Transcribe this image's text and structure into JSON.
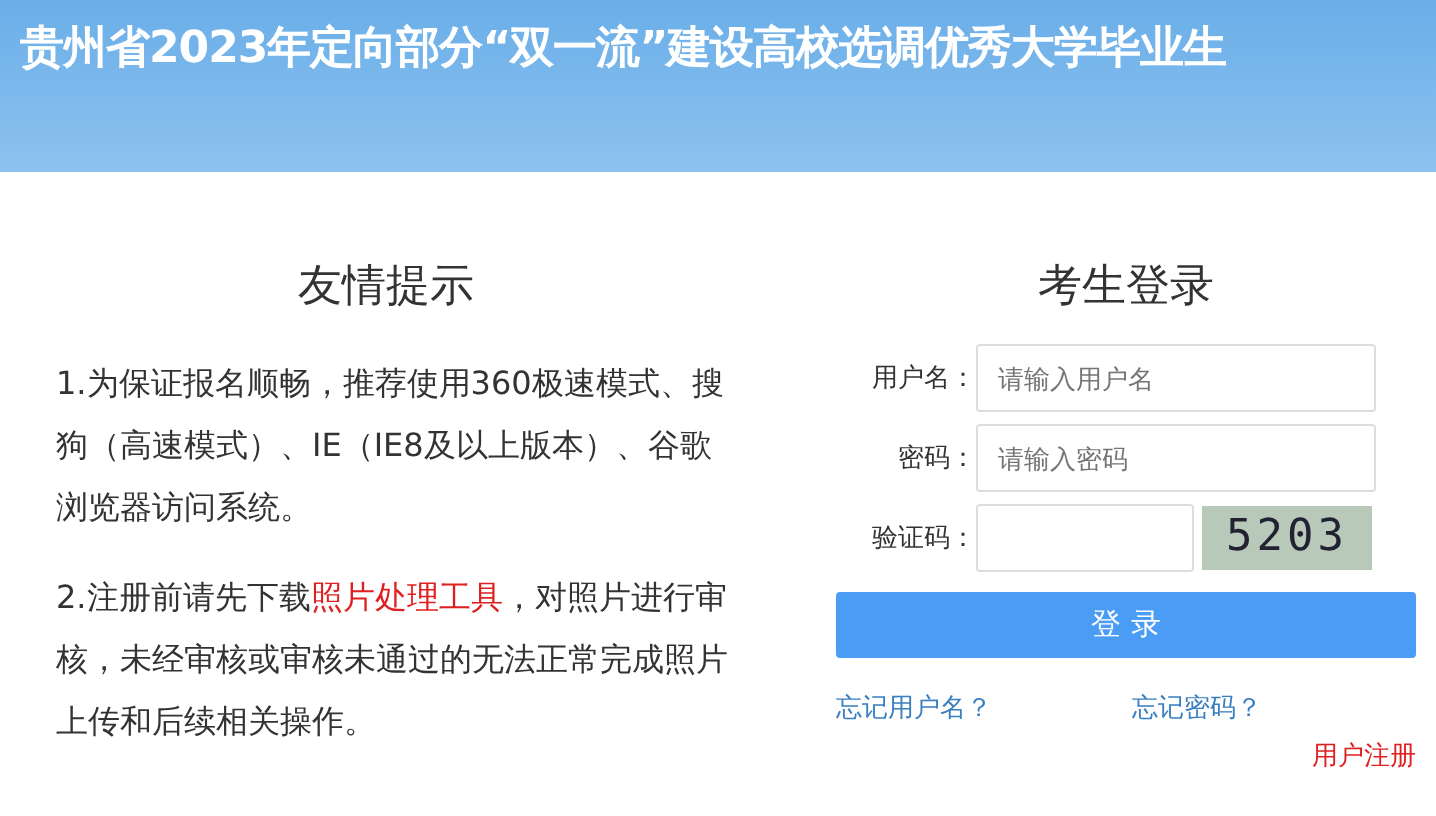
{
  "header": {
    "title": "贵州省2023年定向部分“双一流”建设高校选调优秀大学毕业生"
  },
  "notice": {
    "title": "友情提示",
    "paragraphs": [
      {
        "before": "1.为保证报名顺畅，推荐使用360极速模式、搜狗（高速模式）、IE（IE8及以上版本）、谷歌浏览器访问系统。"
      },
      {
        "before": "2.注册前请先下载",
        "link": "照片处理工具",
        "after": "，对照片进行审核，未经审核或审核未通过的无法正常完成照片上传和后续相关操作。"
      }
    ]
  },
  "login": {
    "title": "考生登录",
    "fields": [
      {
        "kind": "text",
        "label": "用户名：",
        "placeholder": "请输入用户名"
      },
      {
        "kind": "password",
        "label": "密码：",
        "placeholder": "请输入密码"
      },
      {
        "kind": "captcha",
        "label": "验证码：",
        "captcha": "5203"
      }
    ],
    "button": "登 录",
    "forgot_username": "忘记用户名？",
    "forgot_password": "忘记密码？",
    "register": "用户注册"
  }
}
